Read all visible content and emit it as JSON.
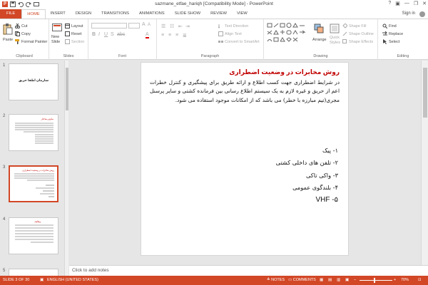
{
  "window": {
    "title": "sazmane_etfae_hariqh [Compatibility Mode] - PowerPoint",
    "help": "?",
    "minimize": "—",
    "restore": "❐",
    "close": "✕",
    "signin": "Sign in"
  },
  "tabs": [
    {
      "label": "FILE"
    },
    {
      "label": "HOME"
    },
    {
      "label": "INSERT"
    },
    {
      "label": "DESIGN"
    },
    {
      "label": "TRANSITIONS"
    },
    {
      "label": "ANIMATIONS"
    },
    {
      "label": "SLIDE SHOW"
    },
    {
      "label": "REVIEW"
    },
    {
      "label": "VIEW"
    }
  ],
  "ribbon": {
    "clipboard": {
      "label": "Clipboard",
      "paste": "Paste",
      "cut": "Cut",
      "copy": "Copy",
      "format_painter": "Format Painter"
    },
    "slides": {
      "label": "Slides",
      "new_slide_1": "New",
      "new_slide_2": "Slide",
      "layout": "Layout",
      "reset": "Reset",
      "section": "Section"
    },
    "font": {
      "label": "Font"
    },
    "paragraph": {
      "label": "Paragraph",
      "text_direction": "Text Direction",
      "align_text": "Align Text",
      "convert_smartart": "Convert to SmartArt"
    },
    "drawing": {
      "label": "Drawing",
      "arrange": "Arrange",
      "quick_styles_1": "Quick",
      "quick_styles_2": "Styles",
      "shape_fill": "Shape Fill",
      "shape_outline": "Shape Outline",
      "shape_effects": "Shape Effects"
    },
    "editing": {
      "label": "Editing",
      "find": "Find",
      "replace": "Replace",
      "select": "Select"
    }
  },
  "thumbnails": [
    {
      "num": "1",
      "title": "سازمان اطفا حریق"
    },
    {
      "num": "2",
      "title": "منابع و ساختار"
    },
    {
      "num": "3",
      "title": "روش مخابرات در وضعیت اضطراری"
    },
    {
      "num": "4",
      "title": "وظایف"
    },
    {
      "num": "5",
      "title": ""
    }
  ],
  "slide": {
    "title": "روش مخابرات در وضعیت اضطراری",
    "body": "در شرایط اضطراری جهت کسب اطلاع و ارائه طریق برای پیشگیری و کنترل خطرات اعم از حریق و غیره لازم به یک سیستم اطلاع رسانی بین فرمانده کشتی و سایر پرسنل مجری(تیم مبارزه با خطر) می باشد که از امکانات موجود استفاده می شود.",
    "list": [
      "۱- پیک",
      "۲- تلفن های داخلی کشتی",
      "۳- واکی تاکی",
      "۴- بلندگوی عمومی",
      "۵- VHF"
    ]
  },
  "notes_placeholder": "Click to add notes",
  "status": {
    "slide_info": "SLIDE 3 OF 30",
    "language": "ENGLISH (UNITED STATES)",
    "notes": "NOTES",
    "comments": "COMMENTS",
    "zoom": "70%"
  },
  "colors": {
    "accent": "#d24726",
    "slide_title": "#c00000"
  }
}
